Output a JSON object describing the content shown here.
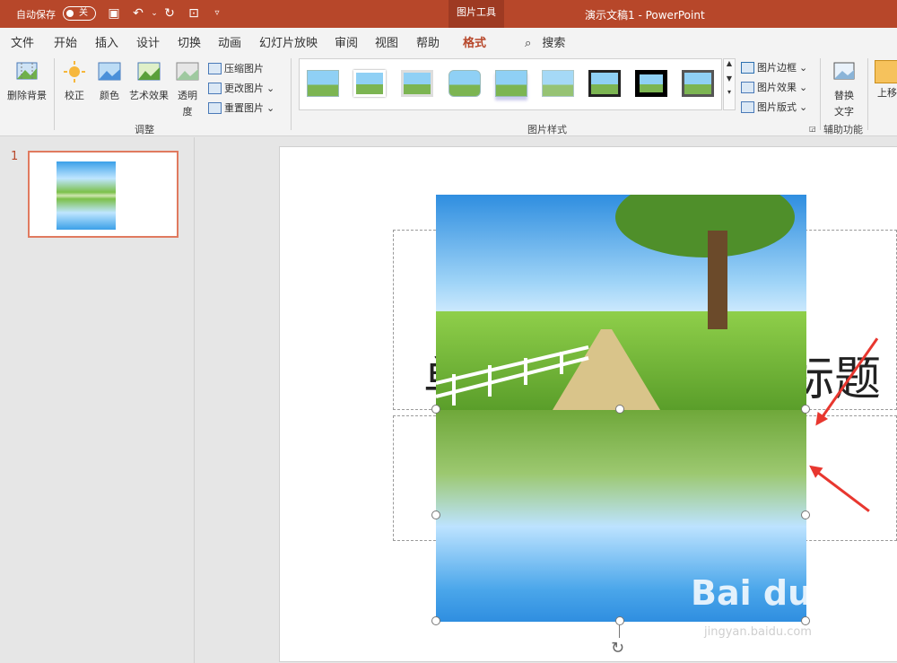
{
  "titlebar": {
    "autosave_label": "自动保存",
    "autosave_state": "关",
    "context_tab": "图片工具",
    "doc_title": "演示文稿1  -  PowerPoint"
  },
  "tabs": [
    "文件",
    "开始",
    "插入",
    "设计",
    "切换",
    "动画",
    "幻灯片放映",
    "审阅",
    "视图",
    "帮助",
    "格式"
  ],
  "active_tab": "格式",
  "search_label": "搜索",
  "ribbon": {
    "remove_bg": "删除背景",
    "corrections": "校正",
    "color": "颜色",
    "artistic": "艺术效果",
    "transparency_line1": "透明",
    "transparency_line2": "度",
    "compress": "压缩图片",
    "change": "更改图片",
    "reset": "重置图片",
    "group_adjust": "调整",
    "group_styles": "图片样式",
    "border": "图片边框",
    "effects": "图片效果",
    "layout": "图片版式",
    "alt_line1": "替换",
    "alt_line2": "文字",
    "group_access": "辅助功能",
    "bring_forward": "上移"
  },
  "slide_panel": {
    "number": "1"
  },
  "slide": {
    "title_left": "单",
    "title_right": "标题"
  },
  "watermark": {
    "text": "Bai du 经验",
    "url": "jingyan.baidu.com"
  },
  "colors": {
    "accent": "#b7472a",
    "arrow": "#e8372f"
  }
}
